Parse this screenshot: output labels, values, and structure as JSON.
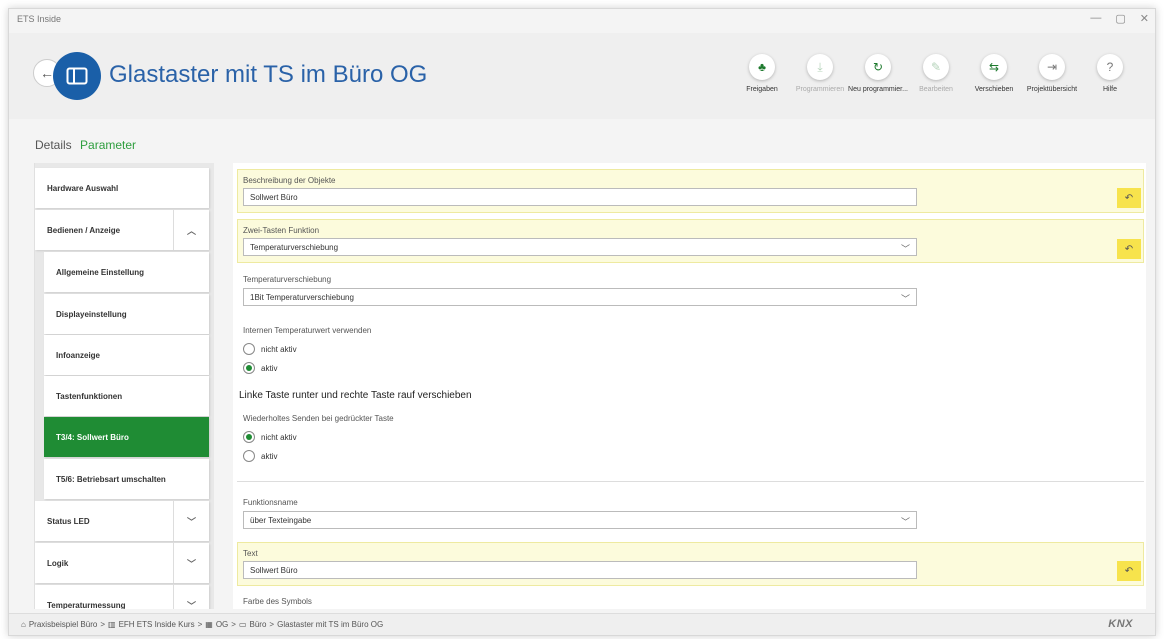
{
  "window": {
    "title": "ETS Inside",
    "controls": [
      "—",
      "▢",
      "✕"
    ]
  },
  "header": {
    "back_icon": "←",
    "title": "Glastaster mit TS im Büro OG",
    "toolbar": [
      {
        "label": "Freigaben",
        "icon": "share-icon",
        "glyph": "♣",
        "state": "enabled"
      },
      {
        "label": "Programmieren",
        "icon": "download-icon",
        "glyph": "⤓",
        "state": "disabled"
      },
      {
        "label": "Neu programmier...",
        "icon": "reload-icon",
        "glyph": "↻",
        "state": "enabled"
      },
      {
        "label": "Bearbeiten",
        "icon": "pencil-icon",
        "glyph": "✎",
        "state": "disabled"
      },
      {
        "label": "Verschieben",
        "icon": "swap-icon",
        "glyph": "⇆",
        "state": "enabled"
      },
      {
        "label": "Projektübersicht",
        "icon": "exit-icon",
        "glyph": "⇥",
        "state": "gray"
      },
      {
        "label": "Hilfe",
        "icon": "help-icon",
        "glyph": "?",
        "state": "gray"
      }
    ]
  },
  "tabs": {
    "details": "Details",
    "parameter": "Parameter"
  },
  "nav": [
    {
      "label": "Hardware Auswahl",
      "level": 1,
      "chevron": ""
    },
    {
      "label": "Bedienen / Anzeige",
      "level": 1,
      "chevron": "︿"
    },
    {
      "label": "Allgemeine Einstellung",
      "level": 2,
      "chevron": ""
    },
    {
      "label": "Displayeinstellung",
      "level": 2,
      "chevron": ""
    },
    {
      "label": "Infoanzeige",
      "level": 2,
      "chevron": ""
    },
    {
      "label": "Tastenfunktionen",
      "level": 2,
      "chevron": ""
    },
    {
      "label": "T3/4: Sollwert Büro",
      "level": 2,
      "chevron": "",
      "selected": true
    },
    {
      "label": "T5/6: Betriebsart umschalten",
      "level": 2,
      "chevron": ""
    },
    {
      "label": "Status LED",
      "level": 1,
      "chevron": "﹀"
    },
    {
      "label": "Logik",
      "level": 1,
      "chevron": "﹀"
    },
    {
      "label": "Temperaturmessung",
      "level": 1,
      "chevron": "﹀"
    }
  ],
  "params": {
    "beschreibung_label": "Beschreibung der Objekte",
    "beschreibung_value": "Sollwert Büro",
    "zwei_tasten_label": "Zwei-Tasten Funktion",
    "zwei_tasten_value": "Temperaturverschiebung",
    "temp_versch_label": "Temperaturverschiebung",
    "temp_versch_value": "1Bit Temperaturverschiebung",
    "intern_label": "Internen Temperaturwert verwenden",
    "intern_opt1": "nicht aktiv",
    "intern_opt2": "aktiv",
    "section_heading": "Linke Taste runter und rechte Taste rauf verschieben",
    "wiederholt_label": "Wiederholtes Senden bei gedrückter Taste",
    "wiederholt_opt1": "nicht aktiv",
    "wiederholt_opt2": "aktiv",
    "funktionsname_label": "Funktionsname",
    "funktionsname_value": "über Texteingabe",
    "text_label": "Text",
    "text_value": "Sollwert Büro",
    "farbe_label": "Farbe des Symbols",
    "undo_glyph": "↶",
    "dropdown_glyph": "﹀"
  },
  "statusbar": {
    "breadcrumb": [
      {
        "icon": "home-icon",
        "glyph": "⌂",
        "text": "Praxisbeispiel Büro"
      },
      {
        "icon": "building-icon",
        "glyph": "▥",
        "text": "EFH ETS Inside Kurs"
      },
      {
        "icon": "floor-icon",
        "glyph": "▦",
        "text": "OG"
      },
      {
        "icon": "room-icon",
        "glyph": "▭",
        "text": "Büro"
      },
      {
        "icon": "",
        "glyph": "",
        "text": "Glastaster mit TS im Büro OG"
      }
    ],
    "separator": ">",
    "logo_text": "KNX"
  },
  "colors": {
    "accent_green": "#1f8c34",
    "title_blue": "#2a62a8",
    "highlight_yellow": "#fcfbdc",
    "undo_yellow": "#f7e34c"
  }
}
